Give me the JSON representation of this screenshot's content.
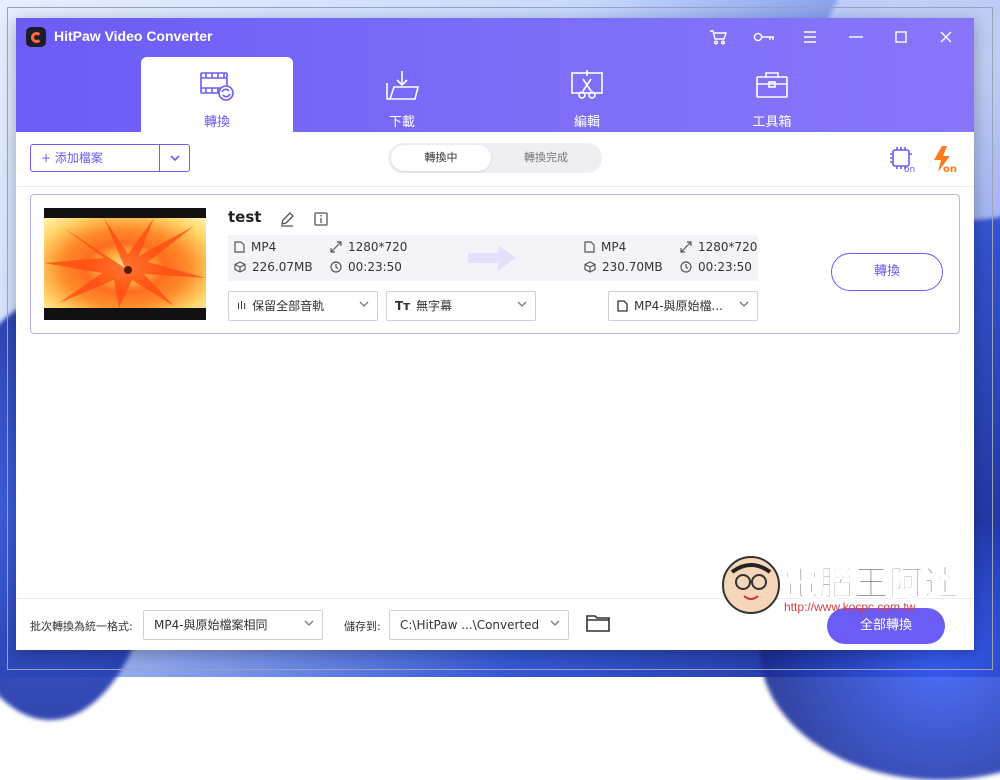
{
  "app": {
    "title": "HitPaw Video Converter"
  },
  "tabs": [
    {
      "label": "轉換",
      "icon": "film-convert-icon",
      "active": true
    },
    {
      "label": "下載",
      "icon": "download-folder-icon",
      "active": false
    },
    {
      "label": "編輯",
      "icon": "scissors-screen-icon",
      "active": false
    },
    {
      "label": "工具箱",
      "icon": "toolbox-icon",
      "active": false
    }
  ],
  "toolbar": {
    "add_files": "添加檔案",
    "segment": {
      "converting": "轉換中",
      "completed": "轉換完成"
    },
    "hw_badge": "on",
    "lightning_badge": "on"
  },
  "file": {
    "name": "test",
    "source": {
      "format": "MP4",
      "resolution": "1280*720",
      "size": "226.07MB",
      "duration": "00:23:50"
    },
    "target": {
      "format": "MP4",
      "resolution": "1280*720",
      "size": "230.70MB",
      "duration": "00:23:50"
    },
    "audio": "保留全部音軌",
    "subtitle": "無字幕",
    "output_format": "MP4-與原始檔...",
    "convert": "轉換"
  },
  "footer": {
    "batch_label": "批次轉換為統一格式:",
    "batch_value": "MP4-與原始檔案相同",
    "save_label": "儲存到:",
    "save_value": "C:\\HitPaw ...\\Converted",
    "convert_all": "全部轉換"
  },
  "watermark": {
    "text": "電腦王阿達",
    "url": "http://www.kocpc.com.tw"
  },
  "colors": {
    "accent": "#6a5cf5",
    "titlebar": "#7566f7"
  }
}
